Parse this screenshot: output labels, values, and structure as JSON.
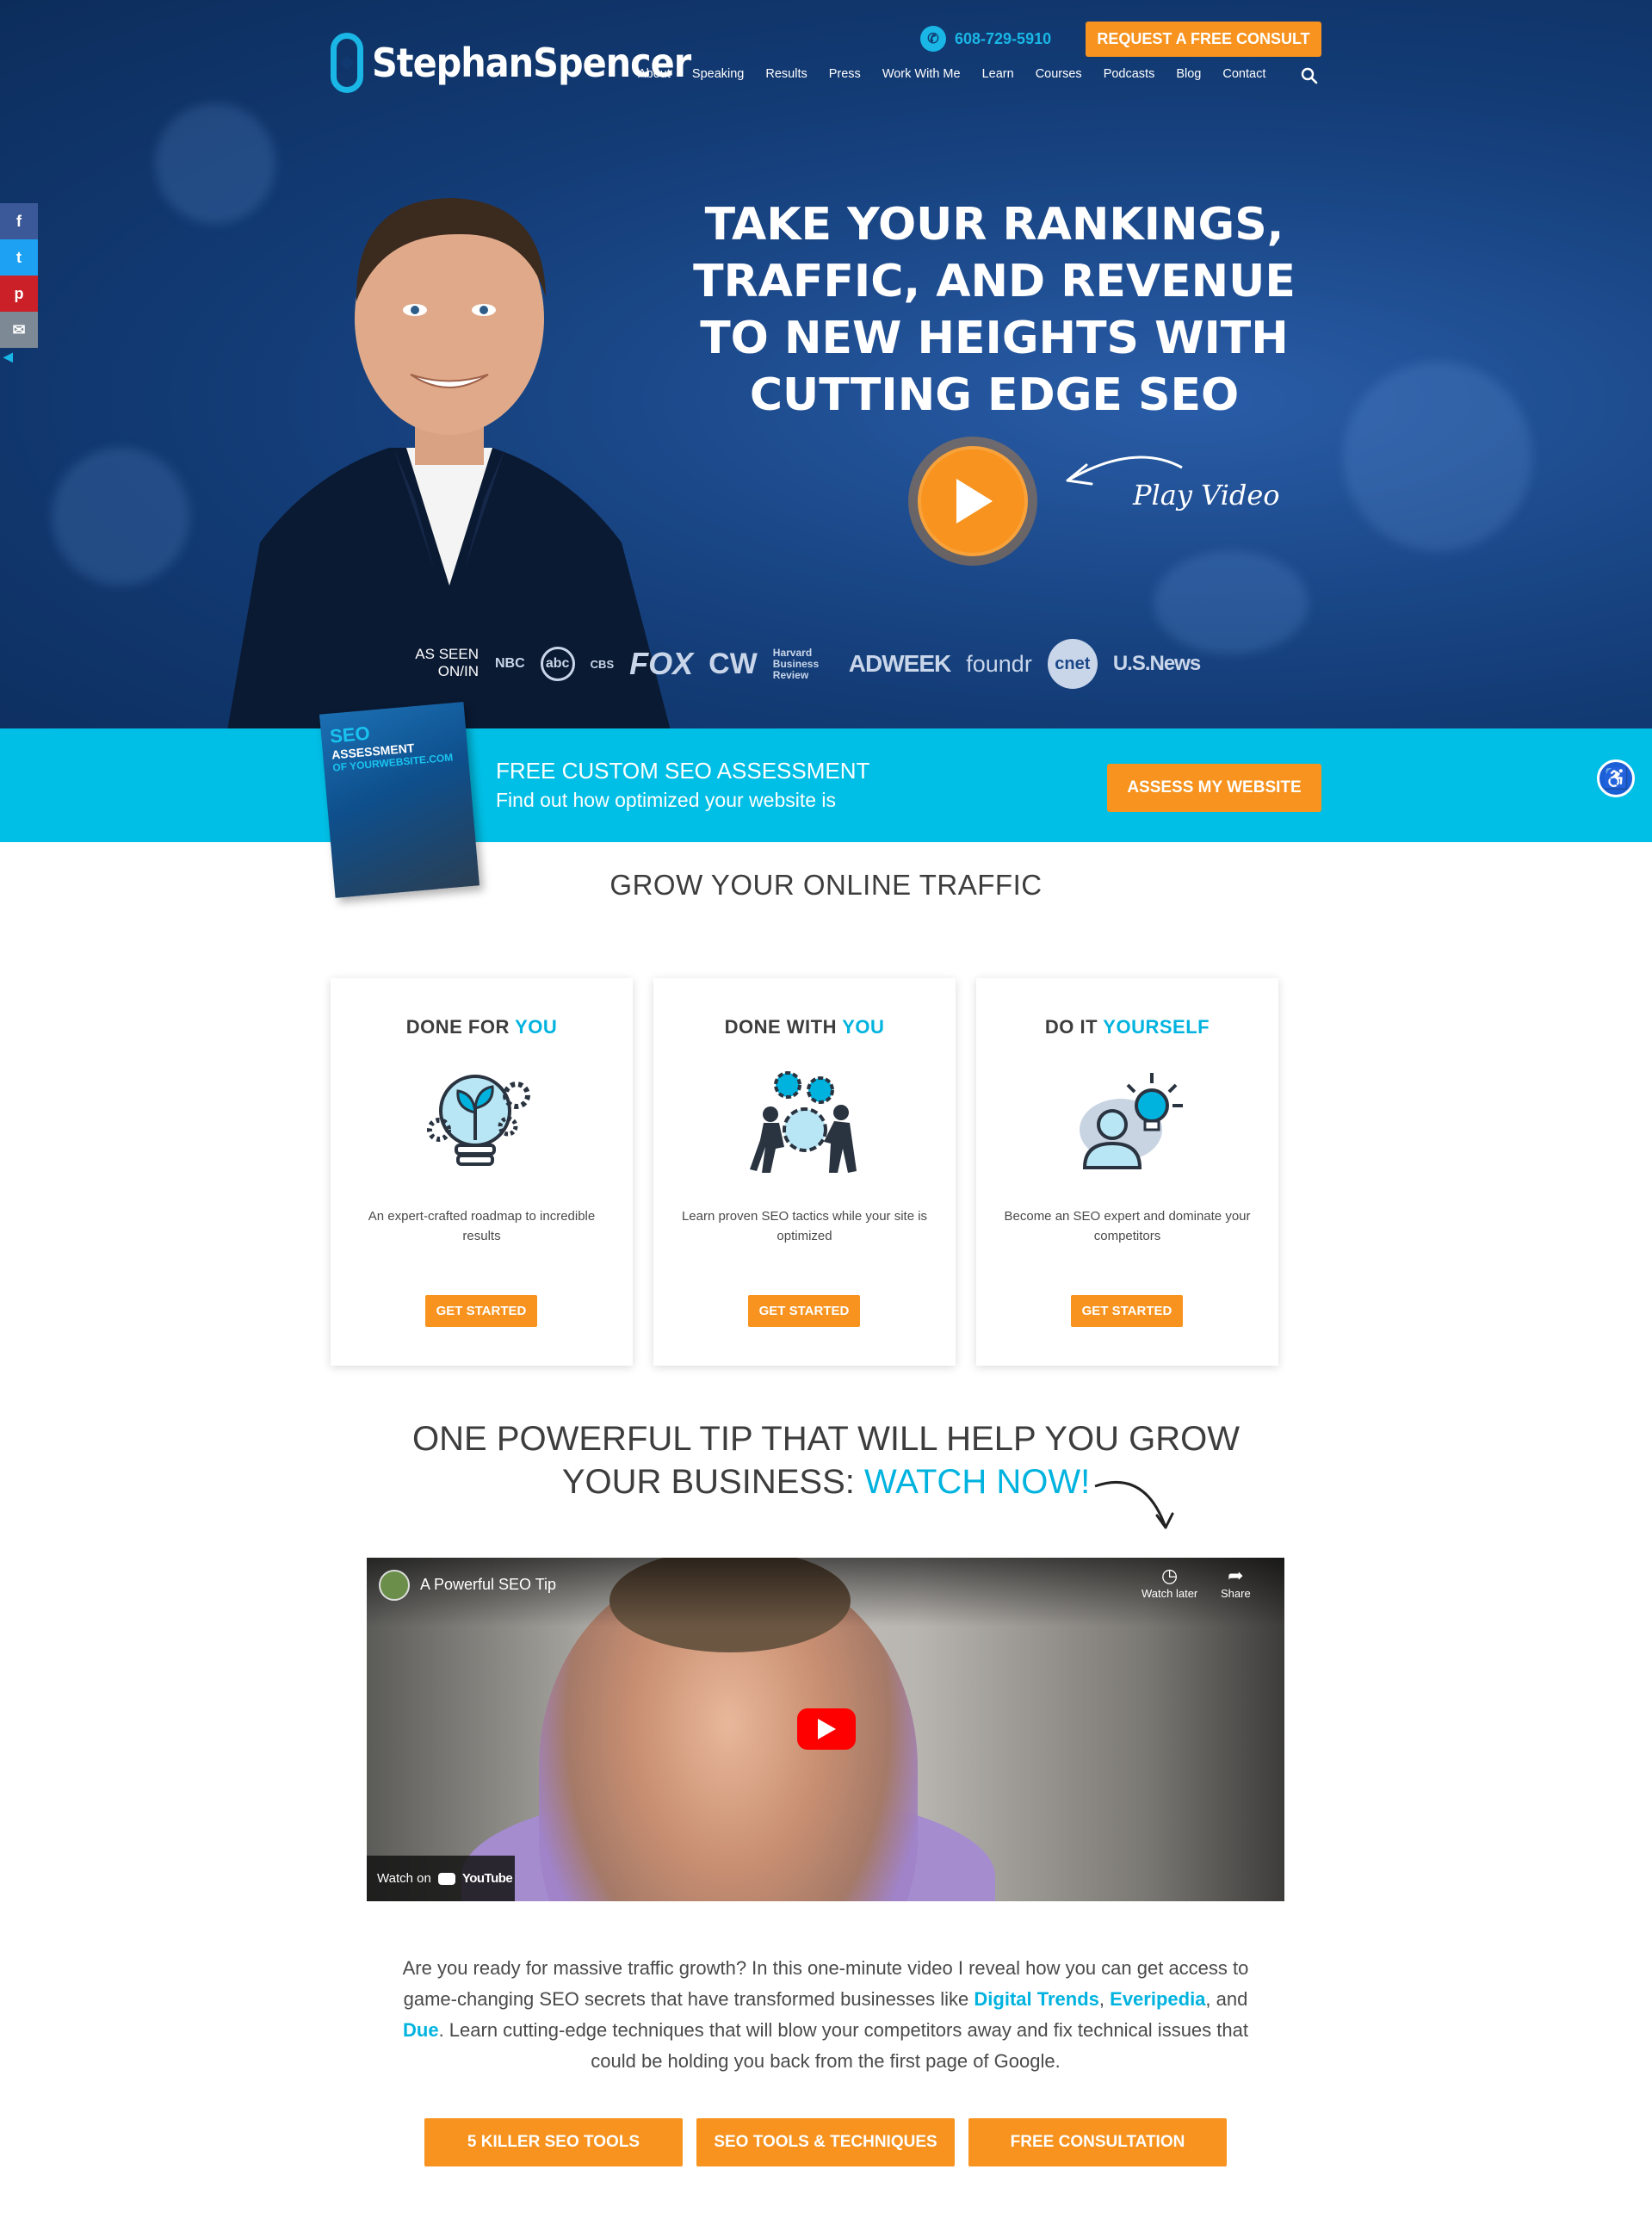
{
  "brand": {
    "name": "StephanSpencer",
    "colors": {
      "accent": "#00b3df",
      "orange": "#f7931e",
      "navy": "#0f3970"
    }
  },
  "header": {
    "phone": "608-729-5910",
    "consult_label": "REQUEST A FREE CONSULT",
    "nav": [
      "About",
      "Speaking",
      "Results",
      "Press",
      "Work With Me",
      "Learn",
      "Courses",
      "Podcasts",
      "Blog",
      "Contact"
    ]
  },
  "hero": {
    "headline": "TAKE YOUR RANKINGS, TRAFFIC, AND REVENUE TO NEW HEIGHTS WITH CUTTING EDGE SEO",
    "play_label": "Play Video",
    "as_seen_label": "AS SEEN ON/IN",
    "media_logos": [
      "NBC",
      "abc",
      "CBS",
      "FOX",
      "CW",
      "Harvard Business Review",
      "ADWEEK",
      "foundr",
      "cnet",
      "U.S.News"
    ]
  },
  "social": [
    "facebook-icon",
    "twitter-icon",
    "pinterest-icon",
    "email-icon"
  ],
  "assessment": {
    "book_line1": "SEO",
    "book_line2": "ASSESSMENT",
    "book_line3": "OF YOURWEBSITE.COM",
    "title": "FREE CUSTOM SEO ASSESSMENT",
    "subtitle": "Find out how optimized your website is",
    "button": "ASSESS MY WEBSITE"
  },
  "grow": {
    "heading": "GROW YOUR ONLINE TRAFFIC"
  },
  "cards": [
    {
      "title_a": "DONE FOR ",
      "title_b": "YOU",
      "text": "An expert-crafted roadmap to incredible results",
      "button": "GET STARTED"
    },
    {
      "title_a": "DONE WITH ",
      "title_b": "YOU",
      "text": "Learn proven SEO tactics while your site is optimized",
      "button": "GET STARTED"
    },
    {
      "title_a": "DO IT ",
      "title_b": "YOURSELF",
      "text": "Become an SEO expert and dominate your competitors",
      "button": "GET STARTED"
    }
  ],
  "tip": {
    "line1": "ONE POWERFUL TIP THAT WILL HELP YOU GROW",
    "line2a": "YOUR BUSINESS: ",
    "line2b": "WATCH NOW!"
  },
  "video": {
    "title": "A Powerful SEO Tip",
    "watch_later": "Watch later",
    "share": "Share",
    "watch_on": "Watch on",
    "youtube": "YouTube"
  },
  "description": {
    "p1": "Are you ready for massive traffic growth? In this one-minute video I reveal how you can get access to game-changing SEO secrets that have transformed businesses like ",
    "link1": "Digital Trends",
    "p2": ", ",
    "link2": "Everipedia",
    "p3": ", and ",
    "link3": "Due",
    "p4": ". Learn cutting-edge techniques that will blow your competitors away and fix technical issues that could be holding you back from the first page of Google."
  },
  "ctas": [
    "5 KILLER SEO TOOLS",
    "SEO TOOLS & TECHNIQUES",
    "FREE CONSULTATION"
  ]
}
